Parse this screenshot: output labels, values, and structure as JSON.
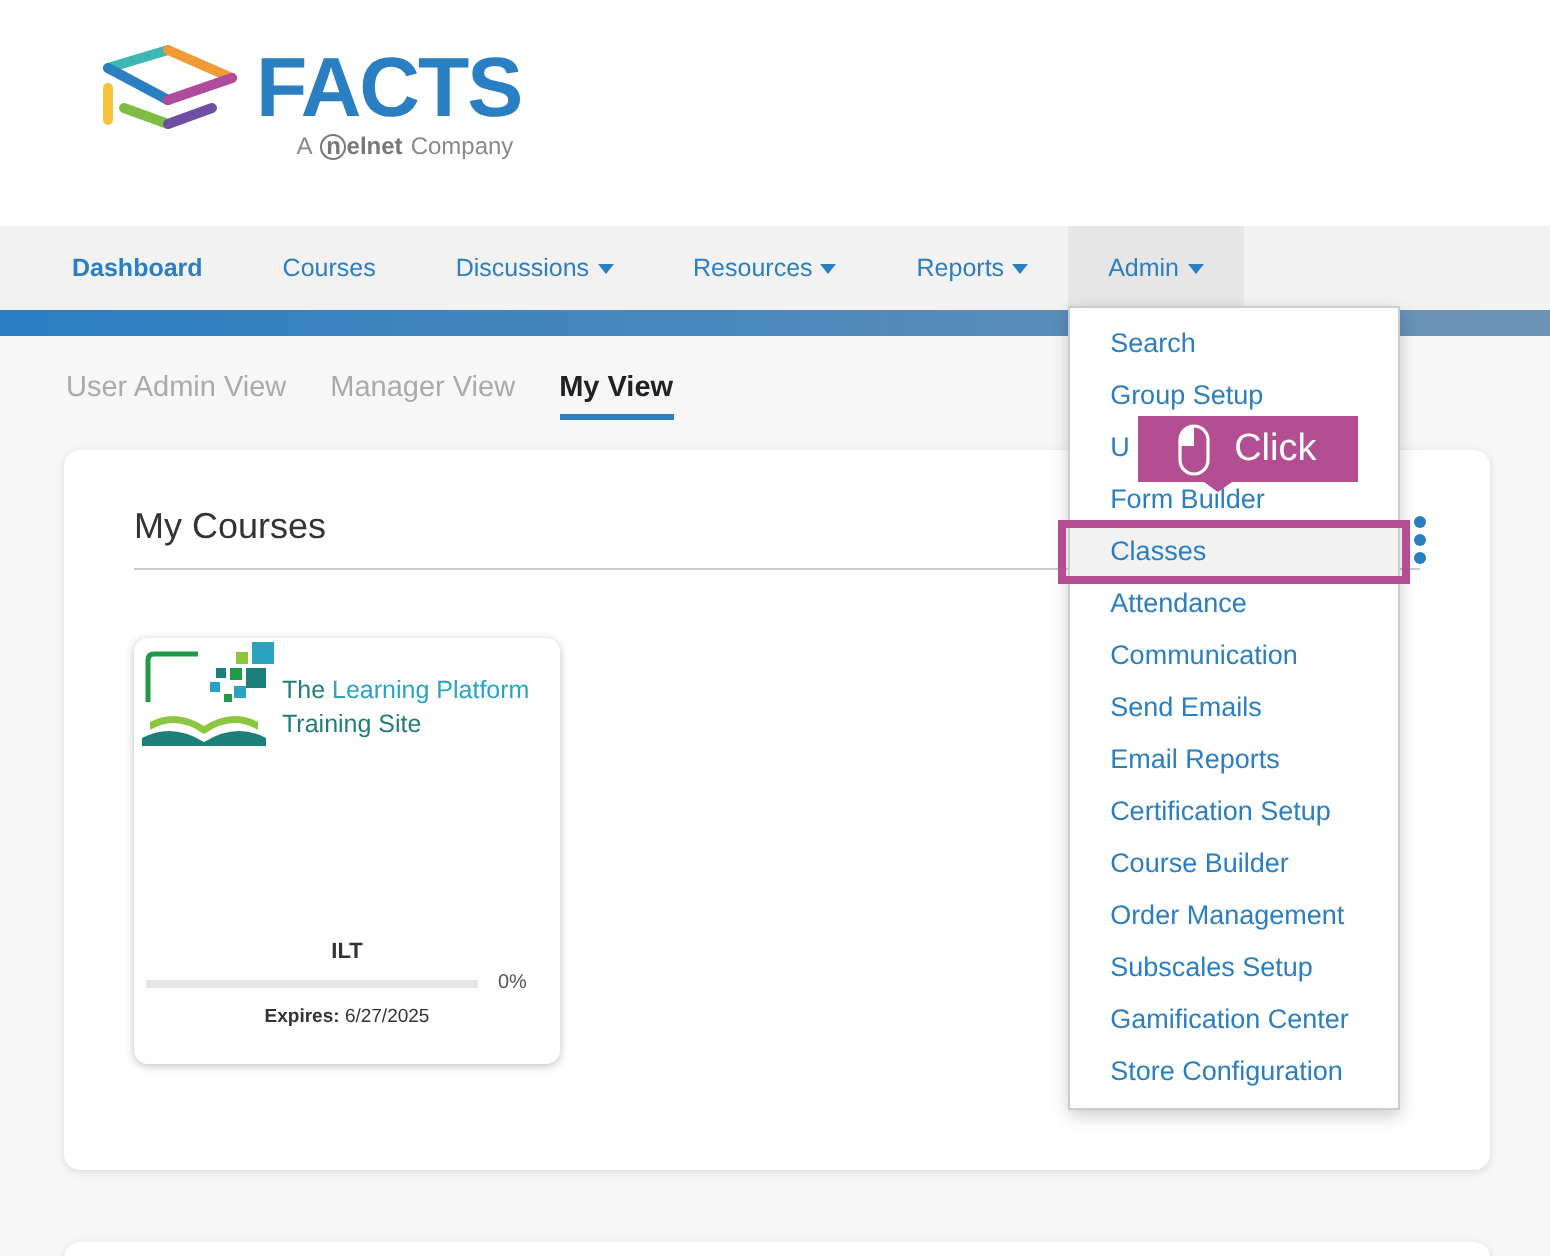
{
  "logo": {
    "brand": "FACTS",
    "tagline_prefix": "A",
    "company": "nelnet",
    "tagline_suffix": "Company"
  },
  "nav": [
    {
      "label": "Dashboard",
      "current": true,
      "dropdown": false,
      "expanded": false
    },
    {
      "label": "Courses",
      "current": false,
      "dropdown": false,
      "expanded": false
    },
    {
      "label": "Discussions",
      "current": false,
      "dropdown": true,
      "expanded": false
    },
    {
      "label": "Resources",
      "current": false,
      "dropdown": true,
      "expanded": false
    },
    {
      "label": "Reports",
      "current": false,
      "dropdown": true,
      "expanded": false
    },
    {
      "label": "Admin",
      "current": false,
      "dropdown": true,
      "expanded": true
    }
  ],
  "admin_menu": [
    {
      "label": "Search",
      "selected": false
    },
    {
      "label": "Group Setup",
      "selected": false
    },
    {
      "label": "U",
      "selected": false
    },
    {
      "label": "Form Builder",
      "selected": false
    },
    {
      "label": "Classes",
      "selected": true
    },
    {
      "label": "Attendance",
      "selected": false
    },
    {
      "label": "Communication",
      "selected": false
    },
    {
      "label": "Send Emails",
      "selected": false
    },
    {
      "label": "Email Reports",
      "selected": false
    },
    {
      "label": "Certification Setup",
      "selected": false
    },
    {
      "label": "Course Builder",
      "selected": false
    },
    {
      "label": "Order Management",
      "selected": false
    },
    {
      "label": "Subscales Setup",
      "selected": false
    },
    {
      "label": "Gamification Center",
      "selected": false
    },
    {
      "label": "Store Configuration",
      "selected": false
    }
  ],
  "callout": {
    "label": "Click"
  },
  "view_tabs": [
    {
      "label": "User Admin View",
      "selected": false
    },
    {
      "label": "Manager View",
      "selected": false
    },
    {
      "label": "My View",
      "selected": true
    }
  ],
  "panel": {
    "title": "My Courses"
  },
  "courses": [
    {
      "image_line1_a": "The",
      "image_line1_b": "Learning Platform",
      "image_line2": "Training Site",
      "type": "ILT",
      "level": 0,
      "percent": "0%",
      "expires_label": "Expires:",
      "expires": "6/27/2025"
    }
  ]
}
